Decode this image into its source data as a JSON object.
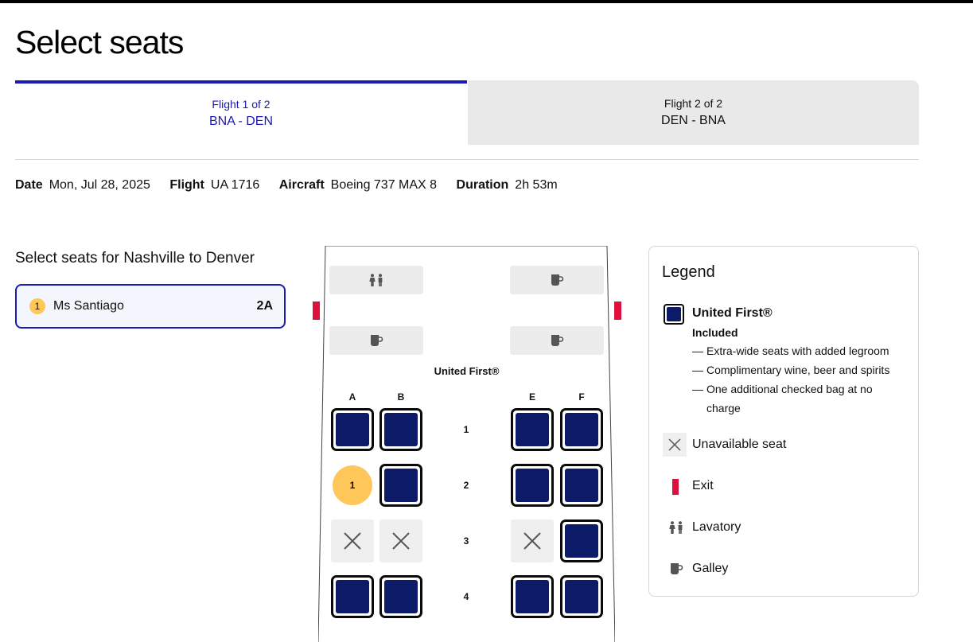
{
  "page": {
    "title": "Select seats"
  },
  "tabs": [
    {
      "small": "Flight 1 of 2",
      "route": "BNA - DEN",
      "active": true
    },
    {
      "small": "Flight 2 of 2",
      "route": "DEN - BNA",
      "active": false
    }
  ],
  "flight_info": {
    "date_label": "Date",
    "date_value": "Mon, Jul 28, 2025",
    "flight_label": "Flight",
    "flight_value": "UA 1716",
    "aircraft_label": "Aircraft",
    "aircraft_value": "Boeing 737 MAX 8",
    "duration_label": "Duration",
    "duration_value": "2h 53m"
  },
  "passenger_section": {
    "title": "Select seats for Nashville to Denver",
    "passengers": [
      {
        "number": "1",
        "name": "Ms Santiago",
        "seat": "2A"
      }
    ]
  },
  "seat_map": {
    "cabin_label": "United First®",
    "columns": [
      "A",
      "B",
      "E",
      "F"
    ],
    "rows": [
      {
        "number": "1",
        "seats": [
          "available",
          "available",
          "available",
          "available"
        ]
      },
      {
        "number": "2",
        "seats": [
          "selected",
          "available",
          "available",
          "available"
        ]
      },
      {
        "number": "3",
        "seats": [
          "unavailable",
          "unavailable",
          "unavailable",
          "available"
        ]
      },
      {
        "number": "4",
        "seats": [
          "available",
          "available",
          "available",
          "available"
        ]
      }
    ],
    "selected_badge": "1",
    "colors": {
      "seat": "#0c1a68",
      "selected": "#ffc75a",
      "exit": "#e0103c",
      "accent": "#1b1bb3"
    }
  },
  "legend": {
    "title": "Legend",
    "cabin_name": "United First®",
    "cabin_included": "Included",
    "bullets": [
      "Extra-wide seats with added legroom",
      "Complimentary wine, beer and spirits",
      "One additional checked bag at no",
      "charge"
    ],
    "unavailable_label": "Unavailable seat",
    "exit_label": "Exit",
    "lavatory_label": "Lavatory",
    "galley_label": "Galley"
  }
}
